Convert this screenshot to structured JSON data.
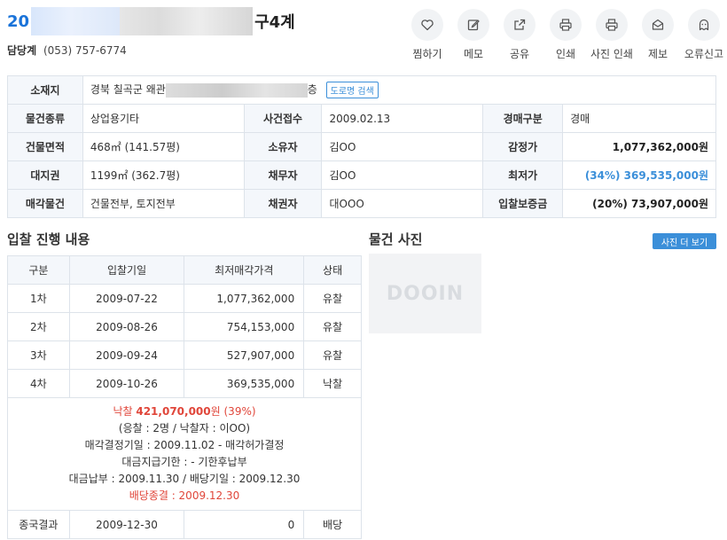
{
  "header": {
    "case_prefix": "20",
    "case_suffix": "구4계",
    "dept_name": "담당계",
    "dept_tel": "(053) 757-6774"
  },
  "actions": [
    {
      "label": "찜하기",
      "icon": "heart-icon"
    },
    {
      "label": "메모",
      "icon": "edit-icon"
    },
    {
      "label": "공유",
      "icon": "share-icon"
    },
    {
      "label": "인쇄",
      "icon": "printer-icon"
    },
    {
      "label": "사진 인쇄",
      "icon": "printer-icon"
    },
    {
      "label": "제보",
      "icon": "mail-icon"
    },
    {
      "label": "오류신고",
      "icon": "ghost-icon"
    }
  ],
  "info": {
    "location_label": "소재지",
    "location_value": "경북 칠곡군 왜관",
    "location_tail": "층",
    "road_search": "도로명 검색",
    "type_label": "물건종류",
    "type_value": "상업용기타",
    "filed_label": "사건접수",
    "filed_value": "2009.02.13",
    "auction_label": "경매구분",
    "auction_value": "경매",
    "bldg_area_label": "건물면적",
    "bldg_area_value": "468㎡ (141.57평)",
    "owner_label": "소유자",
    "owner_value": "김OO",
    "appraisal_label": "감정가",
    "appraisal_value": "1,077,362,000원",
    "land_label": "대지권",
    "land_value": "1199㎡ (362.7평)",
    "debtor_label": "채무자",
    "debtor_value": "김OO",
    "min_label": "최저가",
    "min_value": "(34%) 369,535,000원",
    "sale_label": "매각물건",
    "sale_value": "건물전부, 토지전부",
    "creditor_label": "채권자",
    "creditor_value": "대OOO",
    "deposit_label": "입찰보증금",
    "deposit_value": "(20%) 73,907,000원"
  },
  "bid": {
    "title": "입찰 진행 내용",
    "headers": [
      "구분",
      "입찰기일",
      "최저매각가격",
      "상태"
    ],
    "rows": [
      {
        "round": "1차",
        "date": "2009-07-22",
        "price": "1,077,362,000",
        "status": "유찰"
      },
      {
        "round": "2차",
        "date": "2009-08-26",
        "price": "754,153,000",
        "status": "유찰"
      },
      {
        "round": "3차",
        "date": "2009-09-24",
        "price": "527,907,000",
        "status": "유찰"
      },
      {
        "round": "4차",
        "date": "2009-10-26",
        "price": "369,535,000",
        "status": "낙찰"
      }
    ],
    "summary": {
      "win_label": "낙찰",
      "win_amount": "421,070,000",
      "win_unit": "원",
      "win_pct": "(39%)",
      "bidders": "(응찰 : 2명 / 낙찰자 : 이OO)",
      "decision": "매각결정기일 : 2009.11.02 - 매각허가결정",
      "due": "대금지급기한 : - 기한후납부",
      "payment": "대금납부 : 2009.11.30 / 배당기일 : 2009.12.30",
      "dividend": "배당종결 : 2009.12.30"
    },
    "final": {
      "label": "종국결과",
      "date": "2009-12-30",
      "amount": "0",
      "result": "배당"
    }
  },
  "photos": {
    "title": "물건 사진",
    "more_button": "사진 더 보기",
    "logo": "DOOIN"
  }
}
